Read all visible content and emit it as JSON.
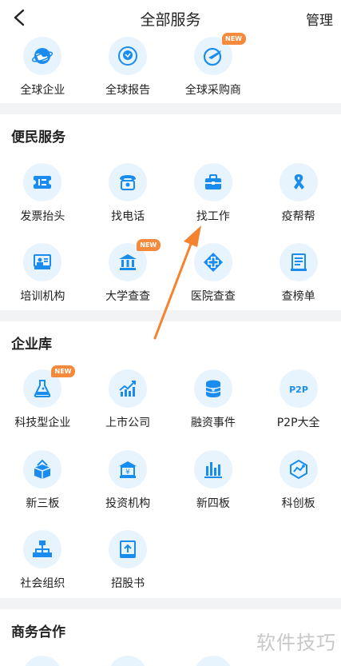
{
  "header": {
    "title": "全部服务",
    "manage": "管理"
  },
  "top_row": [
    {
      "label": "全球企业",
      "icon": "globe-icon",
      "new": false
    },
    {
      "label": "全球报告",
      "icon": "globe-report-icon",
      "new": false
    },
    {
      "label": "全球采购商",
      "icon": "globe-plane-icon",
      "new": true
    }
  ],
  "sections": [
    {
      "title": "便民服务",
      "items": [
        {
          "label": "发票抬头",
          "icon": "invoice-icon",
          "new": false
        },
        {
          "label": "找电话",
          "icon": "telephone-icon",
          "new": false
        },
        {
          "label": "找工作",
          "icon": "briefcase-icon",
          "new": false
        },
        {
          "label": "疫帮帮",
          "icon": "ribbon-icon",
          "new": false
        },
        {
          "label": "培训机构",
          "icon": "training-icon",
          "new": false
        },
        {
          "label": "大学查查",
          "icon": "university-icon",
          "new": true
        },
        {
          "label": "医院查查",
          "icon": "hospital-icon",
          "new": false
        },
        {
          "label": "查榜单",
          "icon": "list-icon",
          "new": false
        }
      ]
    },
    {
      "title": "企业库",
      "items": [
        {
          "label": "科技型企业",
          "icon": "flask-icon",
          "new": true
        },
        {
          "label": "上市公司",
          "icon": "stock-chart-icon",
          "new": false
        },
        {
          "label": "融资事件",
          "icon": "coins-icon",
          "new": false
        },
        {
          "label": "P2P大全",
          "icon": "p2p-icon",
          "new": false
        },
        {
          "label": "新三板",
          "icon": "cube-icon",
          "new": false
        },
        {
          "label": "投资机构",
          "icon": "bank-icon",
          "new": false
        },
        {
          "label": "新四板",
          "icon": "bar-chart-icon",
          "new": false
        },
        {
          "label": "科创板",
          "icon": "innovation-icon",
          "new": false
        },
        {
          "label": "社会组织",
          "icon": "org-chart-icon",
          "new": false
        },
        {
          "label": "招股书",
          "icon": "prospectus-icon",
          "new": false
        }
      ]
    },
    {
      "title": "商务合作",
      "items": []
    }
  ],
  "badge_text": "NEW",
  "watermark": "软件技巧",
  "colors": {
    "accent": "#1a8cf0",
    "icon_bg": "#e8f4fd",
    "badge": "#f58a3c",
    "arrow": "#f5822e"
  }
}
